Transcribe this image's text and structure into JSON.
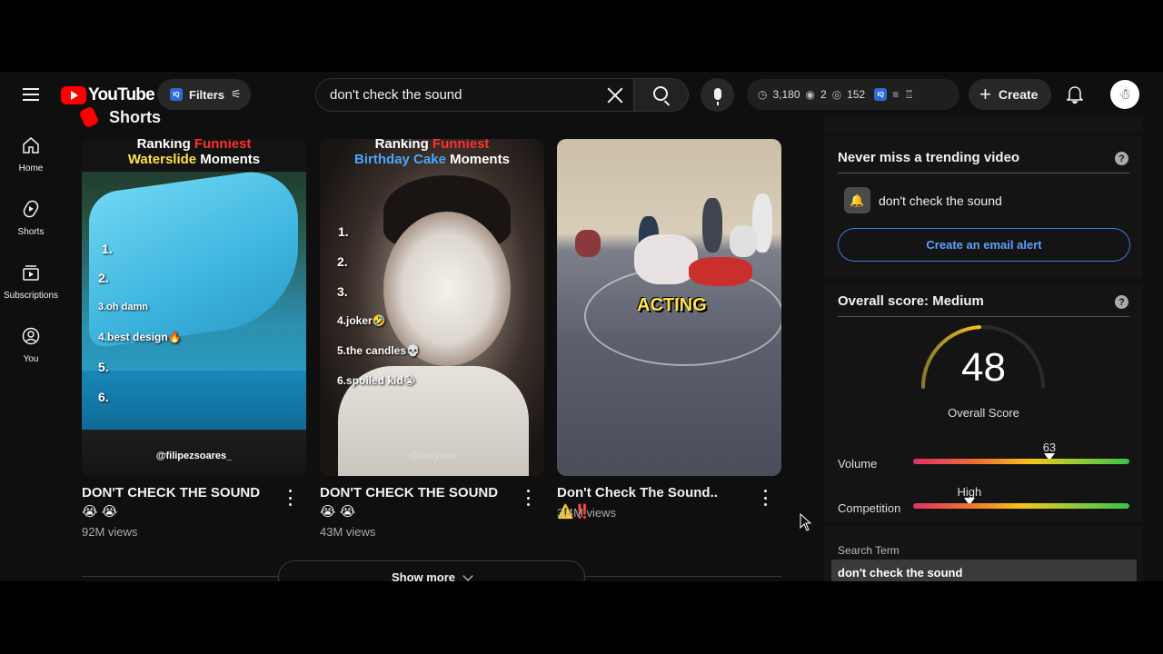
{
  "header": {
    "logo_text": "YouTube",
    "filters_label": "Filters",
    "iq_badge": "IQ",
    "search_value": "don't check the sound",
    "stats": {
      "views": "3,180",
      "watching": "2",
      "other": "152"
    },
    "create_label": "Create"
  },
  "nav": [
    {
      "label": "Home",
      "icon": "home-icon"
    },
    {
      "label": "Shorts",
      "icon": "shorts-icon"
    },
    {
      "label": "Subscriptions",
      "icon": "subscriptions-icon"
    },
    {
      "label": "You",
      "icon": "you-icon"
    }
  ],
  "shorts": {
    "heading": "Shorts",
    "items": [
      {
        "title": "DON'T CHECK THE SOUND 😭 😭",
        "views": "92M views",
        "thumb": {
          "line1_red": "Funniest",
          "line1_pre": "Ranking ",
          "line2_yellow": "Waterslide",
          "line2_post": " Moments",
          "ranks": [
            "1.",
            "2.",
            "3.oh damn",
            "4.best design🔥",
            "5.",
            "6."
          ],
          "handle": "@filipezsoares_"
        }
      },
      {
        "title": "DON'T CHECK THE SOUND 😭 😭",
        "views": "43M views",
        "thumb": {
          "line1_pre": "Ranking ",
          "line1_red": "Funniest",
          "line2_blue": "Birthday Cake",
          "line2_post": " Moments",
          "ranks": [
            "1.",
            "2.",
            "3.",
            "4.joker🤣",
            "5.the candles💀",
            "6.spoiled kid😭"
          ],
          "handle": "@lonlynox"
        }
      },
      {
        "title": "Don't Check The Sound.. ⚠️‼️",
        "views": "3.4M views",
        "thumb": {
          "overlay": "ACTING"
        }
      }
    ],
    "show_more": "Show more"
  },
  "panel": {
    "trending": {
      "title": "Never miss a trending video",
      "alert_term": "don't check the sound",
      "button": "Create an email alert"
    },
    "score": {
      "title": "Overall score: Medium",
      "value": "48",
      "value_pct": 48,
      "label": "Overall Score",
      "volume_label": "Volume",
      "volume_value": "63",
      "volume_pct": 63,
      "competition_label": "Competition",
      "competition_value": "High",
      "competition_pct": 26
    },
    "search_term": {
      "label": "Search Term",
      "value": "don't check the sound"
    }
  },
  "colors": {
    "brand_red": "#ff0000",
    "accent_blue": "#3d7bd9",
    "background": "#0f0f0f"
  }
}
